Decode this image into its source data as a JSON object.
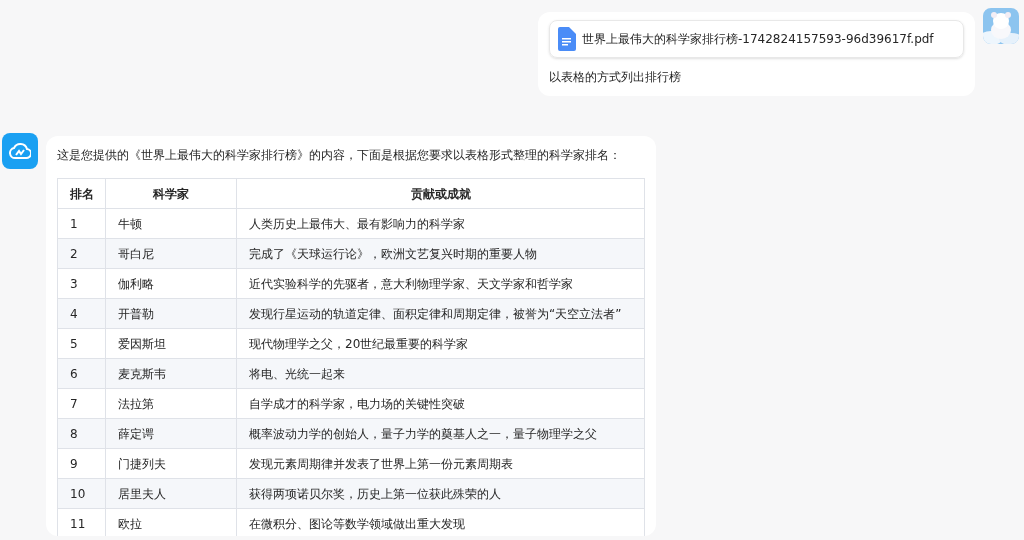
{
  "user_message": {
    "attachment": {
      "file_name": "世界上最伟大的科学家排行榜-1742824157593-96d39617f.pdf"
    },
    "text": "以表格的方式列出排行榜"
  },
  "assistant_message": {
    "intro": "这是您提供的《世界上最伟大的科学家排行榜》的内容，下面是根据您要求以表格形式整理的科学家排名：",
    "table": {
      "columns": [
        "排名",
        "科学家",
        "贡献或成就"
      ],
      "rows": [
        [
          "1",
          "牛顿",
          "人类历史上最伟大、最有影响力的科学家"
        ],
        [
          "2",
          "哥白尼",
          "完成了《天球运行论》，欧洲文艺复兴时期的重要人物"
        ],
        [
          "3",
          "伽利略",
          "近代实验科学的先驱者，意大利物理学家、天文学家和哲学家"
        ],
        [
          "4",
          "开普勒",
          "发现行星运动的轨道定律、面积定律和周期定律，被誉为“天空立法者”"
        ],
        [
          "5",
          "爱因斯坦",
          "现代物理学之父，20世纪最重要的科学家"
        ],
        [
          "6",
          "麦克斯韦",
          "将电、光统一起来"
        ],
        [
          "7",
          "法拉第",
          "自学成才的科学家，电力场的关键性突破"
        ],
        [
          "8",
          "薛定谔",
          "概率波动力学的创始人，量子力学的奠基人之一，量子物理学之父"
        ],
        [
          "9",
          "门捷列夫",
          "发现元素周期律并发表了世界上第一份元素周期表"
        ],
        [
          "10",
          "居里夫人",
          "获得两项诺贝尔奖，历史上第一位获此殊荣的人"
        ],
        [
          "11",
          "欧拉",
          "在微积分、图论等数学领域做出重大发现"
        ]
      ]
    }
  }
}
